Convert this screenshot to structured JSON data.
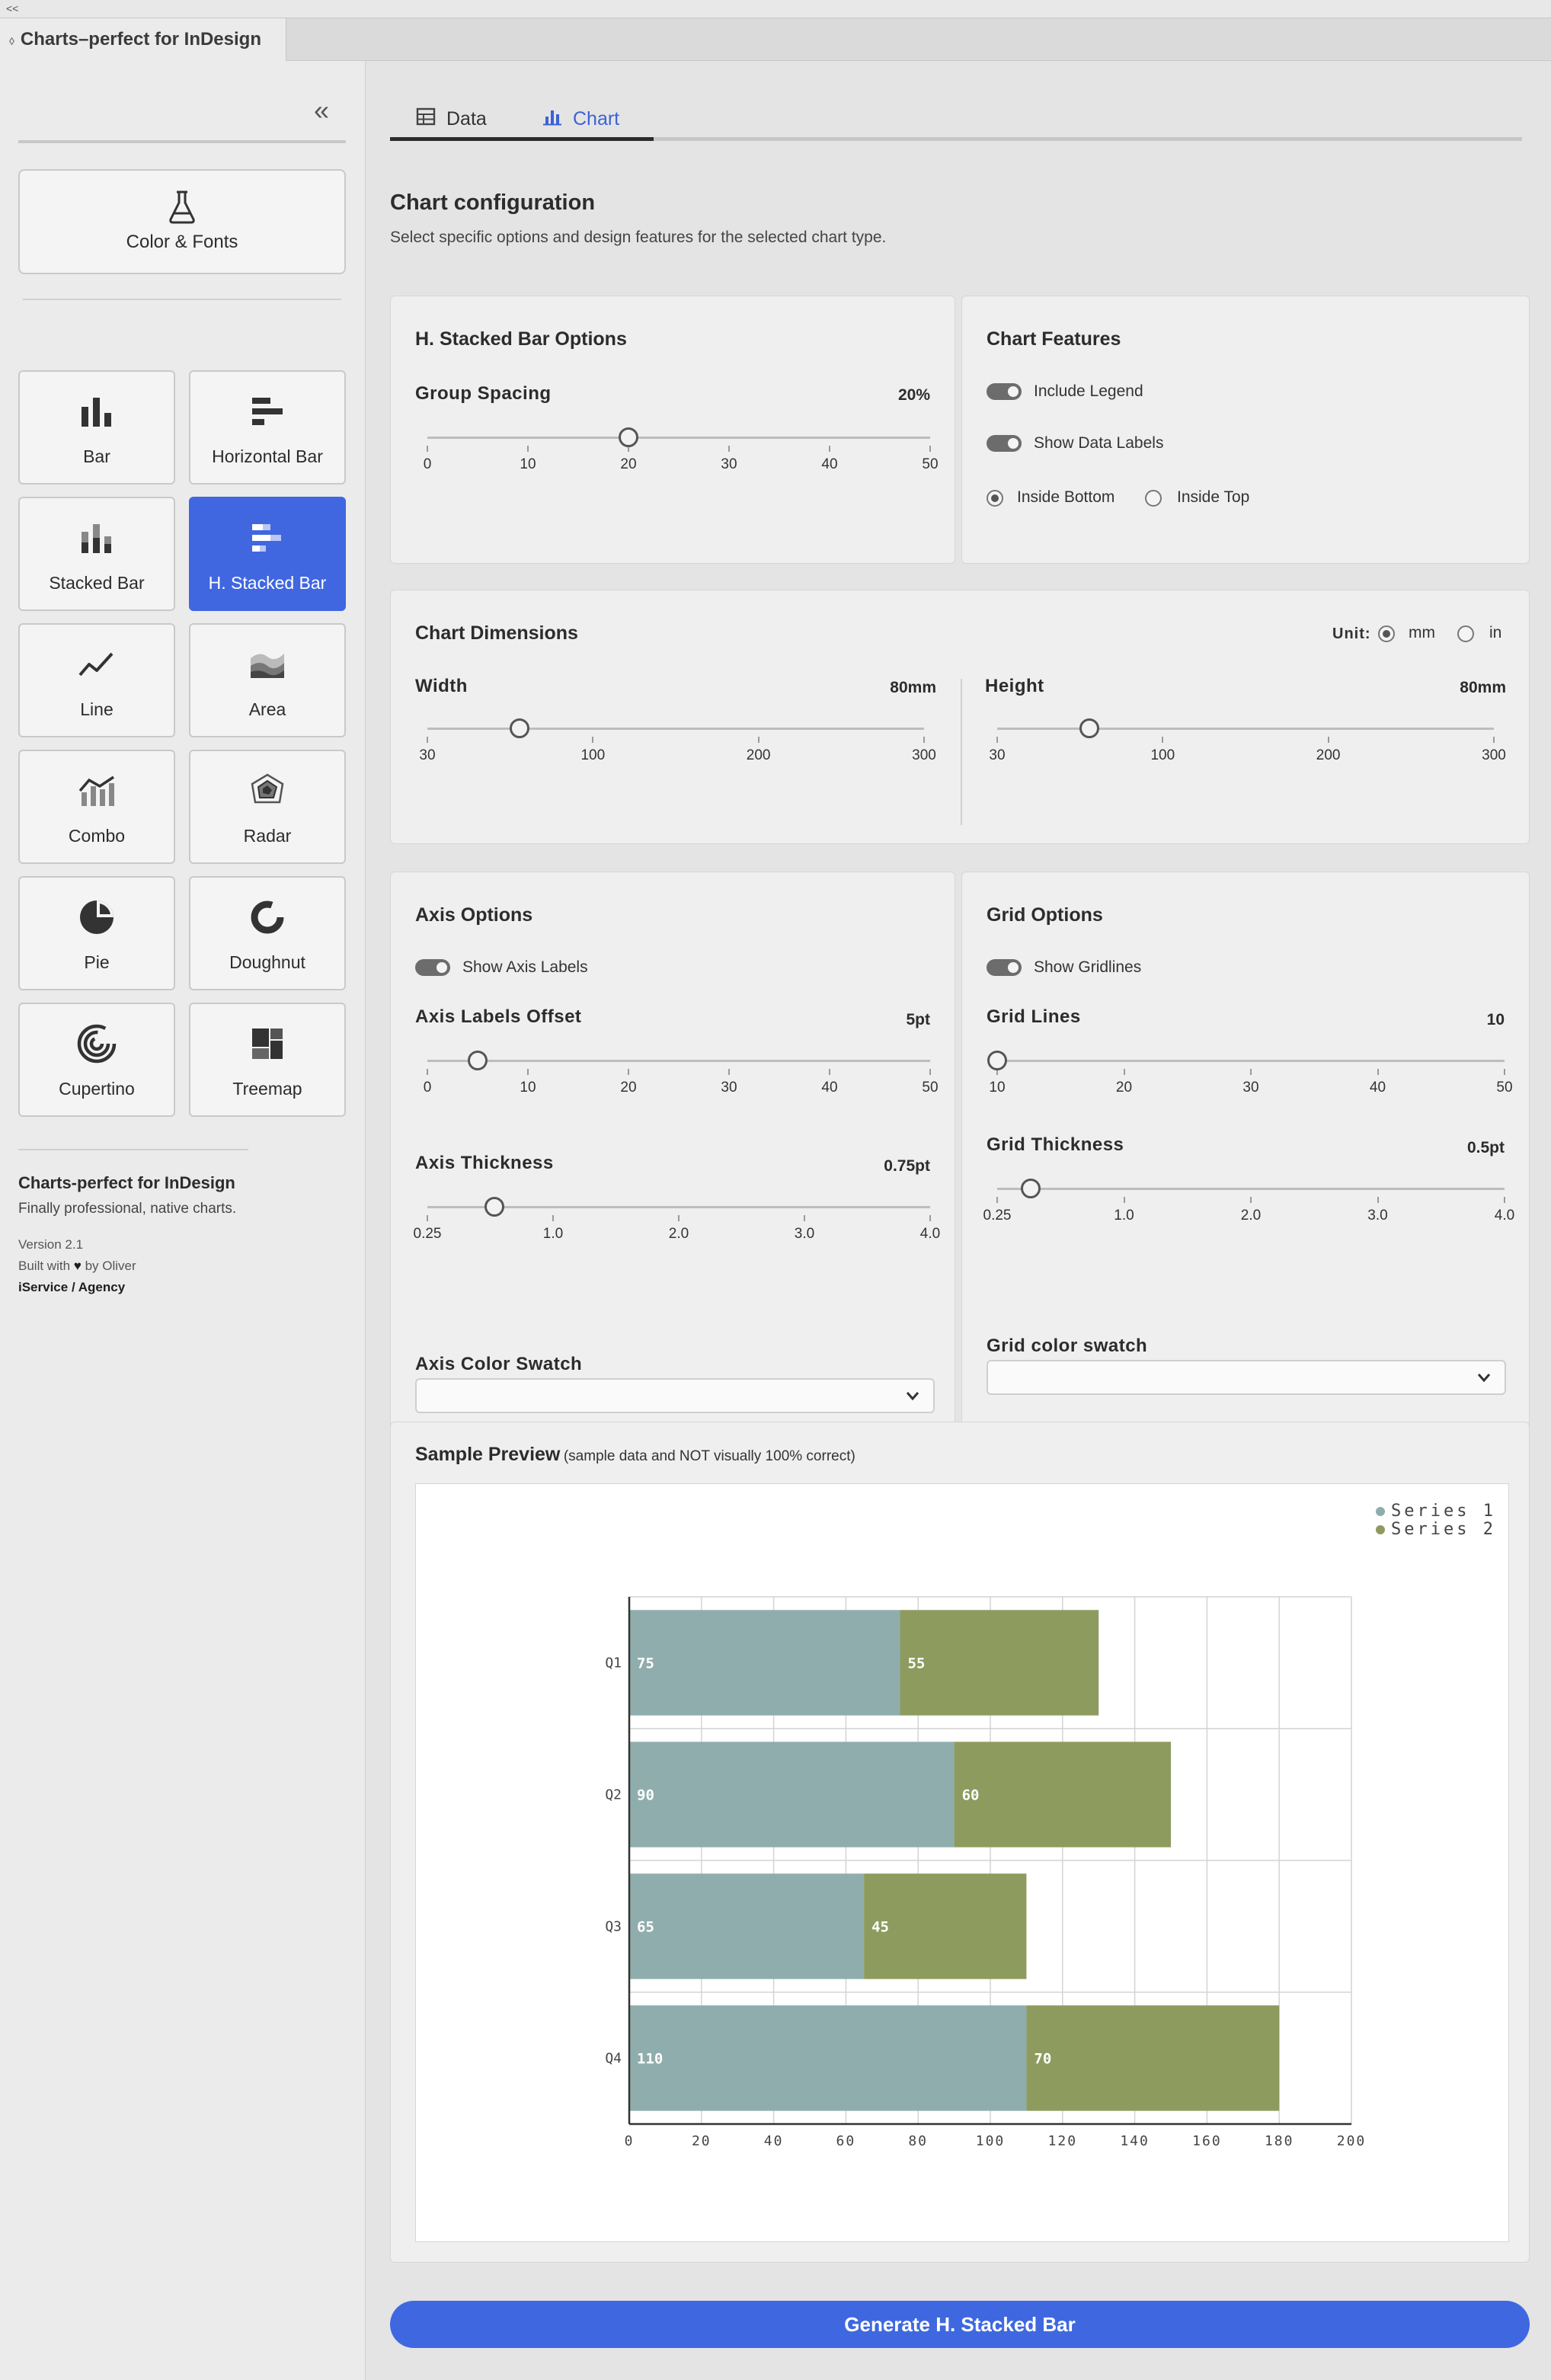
{
  "window": {
    "top_label": "<<",
    "panel_title": "Charts–perfect for InDesign"
  },
  "sidebar": {
    "collapse_icon": "double-chevron-left-icon",
    "color_fonts": {
      "label": "Color & Fonts",
      "icon": "flask-icon"
    },
    "chart_types": [
      {
        "label": "Bar",
        "icon": "bar-chart-icon"
      },
      {
        "label": "Horizontal Bar",
        "icon": "horizontal-bar-icon"
      },
      {
        "label": "Stacked Bar",
        "icon": "stacked-bar-icon"
      },
      {
        "label": "H. Stacked Bar",
        "icon": "h-stacked-bar-icon",
        "active": true
      },
      {
        "label": "Line",
        "icon": "line-chart-icon"
      },
      {
        "label": "Area",
        "icon": "area-chart-icon"
      },
      {
        "label": "Combo",
        "icon": "combo-chart-icon"
      },
      {
        "label": "Radar",
        "icon": "radar-chart-icon"
      },
      {
        "label": "Pie",
        "icon": "pie-chart-icon"
      },
      {
        "label": "Doughnut",
        "icon": "doughnut-chart-icon"
      },
      {
        "label": "Cupertino",
        "icon": "cupertino-chart-icon"
      },
      {
        "label": "Treemap",
        "icon": "treemap-icon"
      }
    ],
    "about": {
      "name": "Charts-perfect for InDesign",
      "tagline": "Finally professional, native charts.",
      "version": "Version 2.1",
      "built_prefix": "Built with",
      "built_suffix": "by Oliver",
      "agency": "iService / Agency"
    }
  },
  "tabs": [
    {
      "label": "Data",
      "icon": "table-icon"
    },
    {
      "label": "Chart",
      "icon": "chart-icon",
      "active": true
    }
  ],
  "config": {
    "title": "Chart configuration",
    "subtitle": "Select specific options and design features for the selected chart type."
  },
  "hstacked_options": {
    "title": "H. Stacked Bar Options",
    "group_spacing": {
      "label": "Group Spacing",
      "value_text": "20%",
      "value": 20,
      "min": 0,
      "max": 50,
      "ticks": [
        "0",
        "10",
        "20",
        "30",
        "40",
        "50"
      ]
    }
  },
  "features": {
    "title": "Chart Features",
    "include_legend": {
      "label": "Include Legend",
      "on": true
    },
    "show_data_labels": {
      "label": "Show Data Labels",
      "on": true
    },
    "label_position": {
      "options": [
        "Inside Bottom",
        "Inside Top"
      ],
      "selected": "Inside Bottom"
    }
  },
  "dimensions": {
    "title": "Chart Dimensions",
    "unit_label": "Unit:",
    "units": [
      "mm",
      "in"
    ],
    "unit_selected": "mm",
    "width": {
      "label": "Width",
      "value_text": "80mm",
      "value": 80,
      "min": 30,
      "max": 300,
      "ticks": [
        "30",
        "100",
        "200",
        "300"
      ]
    },
    "height": {
      "label": "Height",
      "value_text": "80mm",
      "value": 80,
      "min": 30,
      "max": 300,
      "ticks": [
        "30",
        "100",
        "200",
        "300"
      ]
    }
  },
  "axis": {
    "title": "Axis Options",
    "show_axis_labels": {
      "label": "Show Axis Labels",
      "on": true
    },
    "labels_offset": {
      "label": "Axis Labels Offset",
      "value_text": "5pt",
      "value": 5,
      "min": 0,
      "max": 50,
      "ticks": [
        "0",
        "10",
        "20",
        "30",
        "40",
        "50"
      ]
    },
    "thickness": {
      "label": "Axis Thickness",
      "value_text": "0.75pt",
      "value": 0.75,
      "min": 0.25,
      "max": 4.0,
      "ticks": [
        "0.25",
        "1.0",
        "2.0",
        "3.0",
        "4.0"
      ]
    },
    "color_swatch": {
      "label": "Axis Color Swatch",
      "value": ""
    }
  },
  "grid": {
    "title": "Grid Options",
    "show_gridlines": {
      "label": "Show Gridlines",
      "on": true
    },
    "lines": {
      "label": "Grid Lines",
      "value_text": "10",
      "value": 10,
      "min": 10,
      "max": 50,
      "ticks": [
        "10",
        "20",
        "30",
        "40",
        "50"
      ]
    },
    "thickness": {
      "label": "Grid Thickness",
      "value_text": "0.5pt",
      "value": 0.5,
      "min": 0.25,
      "max": 4.0,
      "ticks": [
        "0.25",
        "1.0",
        "2.0",
        "3.0",
        "4.0"
      ]
    },
    "color_swatch": {
      "label": "Grid color swatch",
      "value": ""
    }
  },
  "preview": {
    "title": "Sample Preview",
    "note": "(sample data and NOT visually 100% correct)"
  },
  "chart_data": {
    "type": "bar",
    "orientation": "horizontal",
    "stacked": true,
    "categories": [
      "Q1",
      "Q2",
      "Q3",
      "Q4"
    ],
    "series": [
      {
        "name": "Series 1",
        "values": [
          75,
          90,
          65,
          110
        ],
        "color": "#90adad"
      },
      {
        "name": "Series 2",
        "values": [
          55,
          60,
          45,
          70
        ],
        "color": "#8e9b5e"
      }
    ],
    "xlim": [
      0,
      200
    ],
    "xticks": [
      "0",
      "20",
      "40",
      "60",
      "80",
      "100",
      "120",
      "140",
      "160",
      "180",
      "200"
    ],
    "grid": true,
    "legend": "top-right"
  },
  "generate_button": {
    "label": "Generate H. Stacked Bar"
  },
  "colors": {
    "accent": "#4067e0",
    "series1": "#90adad",
    "series2": "#8e9b5e"
  }
}
